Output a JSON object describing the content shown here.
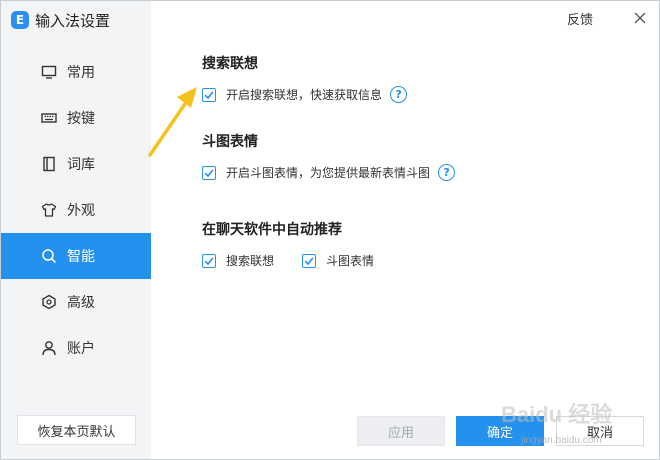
{
  "app": {
    "title": "输入法设置",
    "logo_letter": "E"
  },
  "titlebar": {
    "feedback": "反馈"
  },
  "sidebar": {
    "items": [
      {
        "label": "常用",
        "icon": "monitor-icon"
      },
      {
        "label": "按键",
        "icon": "keyboard-icon"
      },
      {
        "label": "词库",
        "icon": "book-icon"
      },
      {
        "label": "外观",
        "icon": "shirt-icon"
      },
      {
        "label": "智能",
        "icon": "search-icon",
        "active": true
      },
      {
        "label": "高级",
        "icon": "hexagon-icon"
      },
      {
        "label": "账户",
        "icon": "user-icon"
      }
    ],
    "reset_label": "恢复本页默认"
  },
  "sections": {
    "search": {
      "title": "搜索联想",
      "option": "开启搜索联想，快速获取信息",
      "checked": true
    },
    "sticker": {
      "title": "斗图表情",
      "option": "开启斗图表情，为您提供最新表情斗图",
      "checked": true
    },
    "chat": {
      "title": "在聊天软件中自动推荐",
      "opt1": "搜索联想",
      "opt2": "斗图表情"
    }
  },
  "help_glyph": "?",
  "buttons": {
    "apply": "应用",
    "ok": "确定",
    "cancel": "取消"
  },
  "watermark": {
    "main": "Baidu 经验",
    "sub": "jingyan.baidu.com"
  },
  "colors": {
    "accent": "#2491ee",
    "arrow": "#f5c21b"
  }
}
